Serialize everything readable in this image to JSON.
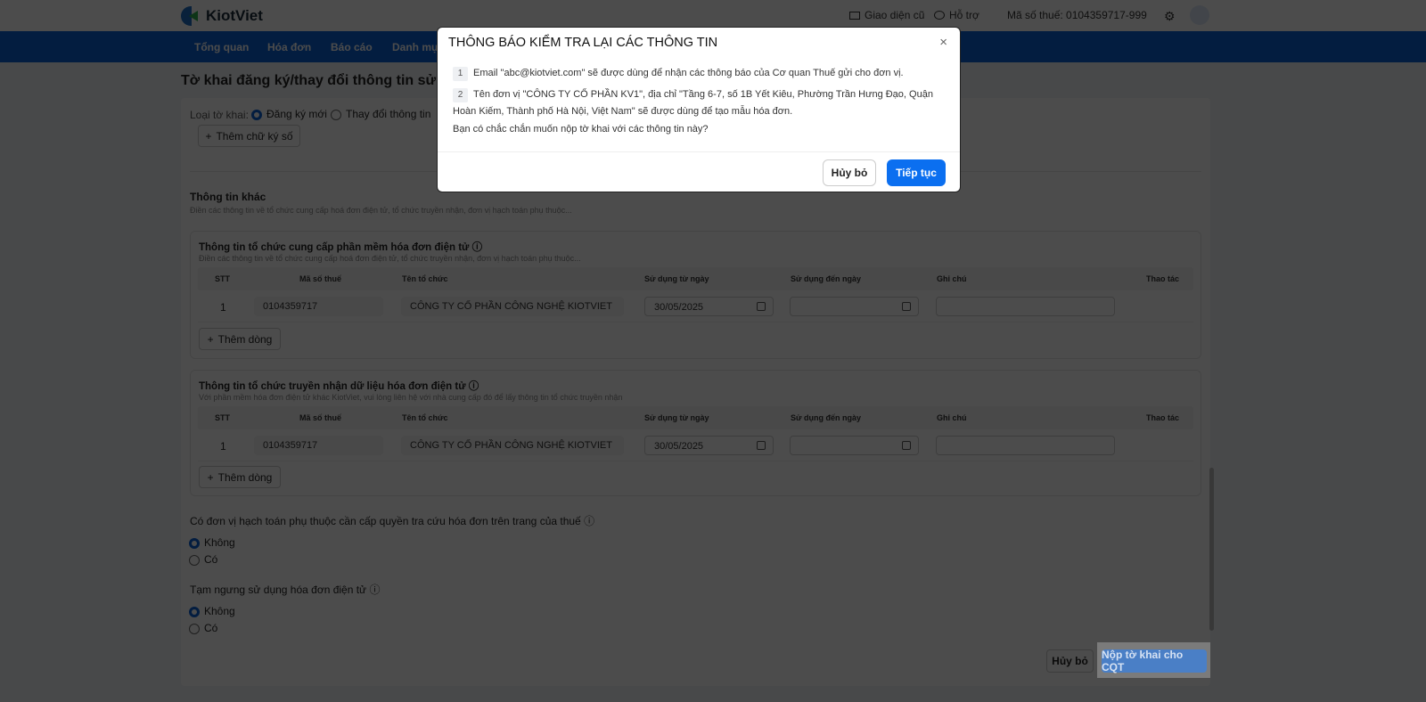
{
  "header": {
    "brand": "KiotViet",
    "old_ui": "Giao diện cũ",
    "support": "Hỗ trợ",
    "tax_code": "Mã số thuế: 0104359717-999"
  },
  "nav": [
    "Tổng quan",
    "Hóa đơn",
    "Báo cáo",
    "Danh mục"
  ],
  "page": {
    "title": "Tờ khai đăng ký/thay đổi thông tin sử dụng",
    "form_type_label": "Loại tờ khai:",
    "form_type_options": [
      "Đăng ký mới",
      "Thay đổi thông tin"
    ],
    "form_type_selected": "Đăng ký mới",
    "add_signature": "Thêm chữ ký số",
    "other_title": "Thông tin khác",
    "other_desc": "Điền các thông tin về tổ chức cung cấp hoá đơn điện tử, tổ chức truyền nhận, đơn vị hạch toán phụ thuộc...",
    "columns": [
      "STT",
      "Mã số thuế",
      "Tên tổ chức",
      "Sử dụng từ ngày",
      "Sử dụng đến ngày",
      "Ghi chú",
      "Thao tác"
    ],
    "sections": [
      {
        "title": "Thông tin tổ chức cung cấp phần mềm hóa đơn điện tử",
        "desc": "Điền các thông tin về tổ chức cung cấp hoá đơn điện tử, tổ chức truyền nhận, đơn vị hạch toán phụ thuộc...",
        "row": {
          "stt": "1",
          "tax": "0104359717",
          "name": "CÔNG TY CỔ PHẦN CÔNG NGHỆ KIOTVIET",
          "from": "30/05/2025",
          "to": "",
          "note": ""
        },
        "add_row": "Thêm dòng"
      },
      {
        "title": "Thông tin tổ chức truyền nhận dữ liệu hóa đơn điện tử",
        "desc": "Với phần mềm hóa đơn điện tử khác KiotViet, vui lòng liên hệ với nhà cung cấp đó để lấy thông tin tổ chức truyền nhận",
        "row": {
          "stt": "1",
          "tax": "0104359717",
          "name": "CÔNG TY CỔ PHẦN CÔNG NGHỆ KIOTVIET",
          "from": "30/05/2025",
          "to": "",
          "note": ""
        },
        "add_row": "Thêm dòng"
      }
    ],
    "q1": {
      "label": "Có đơn vị hạch toán phụ thuộc cần cấp quyền tra cứu hóa đơn trên trang của thuế",
      "options": [
        "Không",
        "Có"
      ],
      "selected": "Không"
    },
    "q2": {
      "label": "Tạm ngưng sử dụng hóa đơn điện tử",
      "options": [
        "Không",
        "Có"
      ],
      "selected": "Không"
    },
    "cancel": "Hủy bỏ",
    "submit": "Nộp tờ khai cho CQT"
  },
  "modal": {
    "title": "THÔNG BÁO KIỂM TRA LẠI CÁC THÔNG TIN",
    "items": [
      {
        "n": "1",
        "text": "Email \"abc@kiotviet.com\" sẽ được dùng để nhận các thông báo của Cơ quan Thuế gửi cho đơn vị."
      },
      {
        "n": "2",
        "text": "Tên đơn vị \"CÔNG TY CỔ PHẦN KV1\", địa chỉ \"Tầng 6-7, số 1B Yết Kiêu, Phường Trần Hưng Đạo, Quận Hoàn Kiếm, Thành phố Hà Nội, Việt Nam\" sẽ được dùng để tạo mẫu hóa đơn."
      }
    ],
    "question": "Bạn có chắc chắn muốn nộp tờ khai với các thông tin này?",
    "cancel": "Hủy bỏ",
    "confirm": "Tiếp tục"
  },
  "colors": {
    "primary": "#0b62d6",
    "brand_green": "#2bb24c"
  }
}
